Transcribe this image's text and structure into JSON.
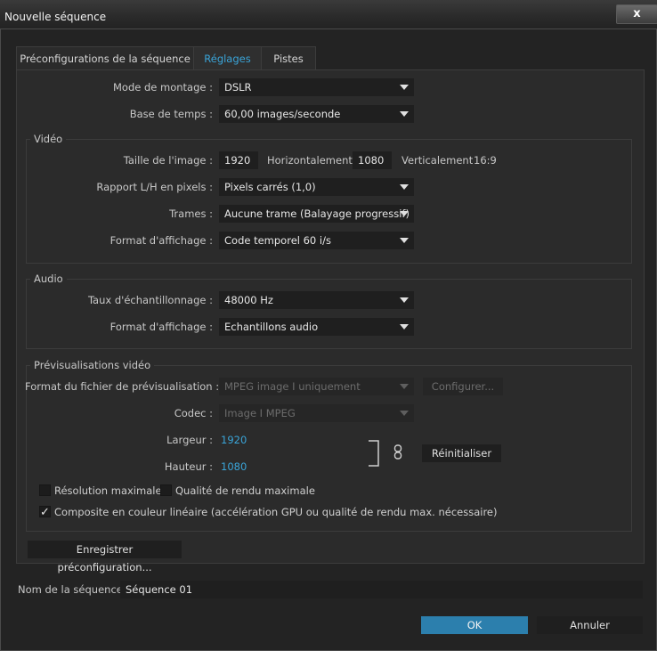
{
  "window": {
    "title": "Nouvelle séquence",
    "close_label": "x"
  },
  "tabs": [
    {
      "label": "Préconfigurations de la séquence",
      "active": false
    },
    {
      "label": "Réglages",
      "active": true
    },
    {
      "label": "Pistes",
      "active": false
    }
  ],
  "general": {
    "edit_mode_label": "Mode de montage :",
    "edit_mode_value": "DSLR",
    "timebase_label": "Base de temps :",
    "timebase_value": "60,00 images/seconde"
  },
  "video": {
    "title": "Vidéo",
    "frame_size_label": "Taille de l'image :",
    "frame_width": "1920",
    "horizontal_label": "Horizontalement",
    "frame_height": "1080",
    "vertical_label": "Verticalement",
    "aspect_ratio": "16:9",
    "pixel_aspect_label": "Rapport L/H en pixels :",
    "pixel_aspect_value": "Pixels carrés (1,0)",
    "fields_label": "Trames :",
    "fields_value": "Aucune trame (Balayage progressif)",
    "display_format_label": "Format d'affichage :",
    "display_format_value": "Code temporel 60 i/s"
  },
  "audio": {
    "title": "Audio",
    "sample_rate_label": "Taux d'échantillonnage :",
    "sample_rate_value": "48000 Hz",
    "display_format_label": "Format d'affichage :",
    "display_format_value": "Echantillons audio"
  },
  "preview": {
    "title": "Prévisualisations vidéo",
    "file_format_label": "Format du fichier de prévisualisation :",
    "file_format_value": "MPEG image I uniquement",
    "configure_label": "Configurer...",
    "codec_label": "Codec :",
    "codec_value": "Image I MPEG",
    "width_label": "Largeur :",
    "width_value": "1920",
    "height_label": "Hauteur :",
    "height_value": "1080",
    "reset_label": "Réinitialiser"
  },
  "options": {
    "max_resolution": {
      "label": "Résolution maximale",
      "checked": false
    },
    "max_quality": {
      "label": "Qualité de rendu maximale",
      "checked": false
    },
    "linear_composite": {
      "label": "Composite en couleur linéaire (accélération GPU ou qualité de rendu max. nécessaire)",
      "checked": true
    },
    "check_glyph": "✓"
  },
  "save_preset_label": "Enregistrer préconfiguration...",
  "sequence_name_label": "Nom de la séquence :",
  "sequence_name_value": "Séquence 01",
  "ok_label": "OK",
  "cancel_label": "Annuler",
  "colors": {
    "accent": "#3aa5d9",
    "ok_button": "#2c7fad",
    "panel": "#2b2b2b",
    "field": "#1f1f1f"
  },
  "icons": {
    "link": "chain-link-icon",
    "dropdown": "chevron-down-icon",
    "close": "close-icon"
  }
}
